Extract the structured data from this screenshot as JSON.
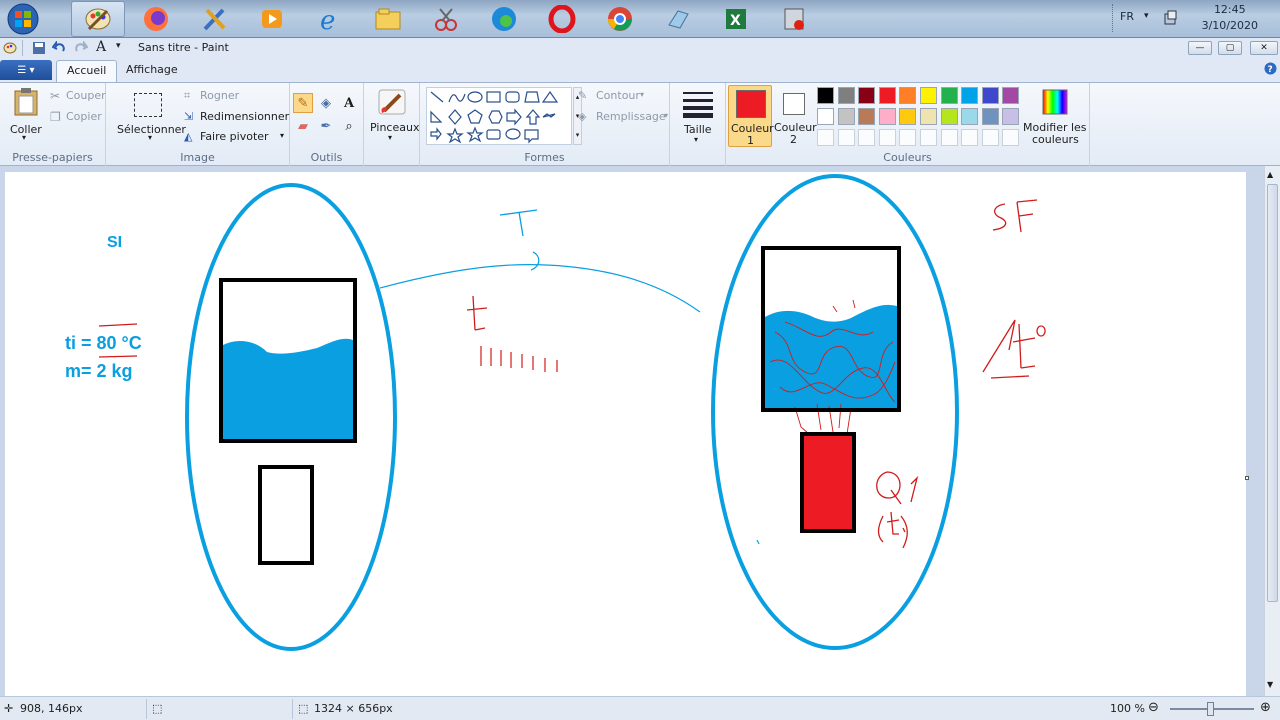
{
  "taskbar": {
    "apps": [
      "paint-icon",
      "firefox-icon",
      "brushes-app-icon",
      "media-player-icon",
      "internet-explorer-icon",
      "file-explorer-icon",
      "snipping-tool-icon",
      "edge-icon",
      "opera-icon",
      "chrome-icon",
      "notes-app-icon",
      "excel-icon",
      "recorder-icon"
    ],
    "lang": "FR",
    "time": "12:45",
    "date": "3/10/2020"
  },
  "window": {
    "title": "Sans titre - Paint",
    "min": "—",
    "max": "▢",
    "close": "✕"
  },
  "tabs": {
    "accueil": "Accueil",
    "affichage": "Affichage"
  },
  "ribbon": {
    "clipboard": {
      "coller": "Coller",
      "couper": "Couper",
      "copier": "Copier",
      "label": "Presse-papiers"
    },
    "image": {
      "selectionner": "Sélectionner",
      "rogner": "Rogner",
      "redimensionner": "Redimensionner",
      "faire_pivoter": "Faire pivoter",
      "label": "Image"
    },
    "tools": {
      "label": "Outils"
    },
    "brushes": {
      "label": "Pinceaux"
    },
    "shapes": {
      "contour": "Contour",
      "remplissage": "Remplissage",
      "label": "Formes"
    },
    "size": {
      "label": "Taille"
    },
    "colors": {
      "couleur1_a": "Couleur",
      "couleur1_b": "1",
      "couleur2_a": "Couleur",
      "couleur2_b": "2",
      "modifier_a": "Modifier les",
      "modifier_b": "couleurs",
      "label": "Couleurs",
      "color1": "#ed1c24",
      "color2": "#ffffff",
      "row1": [
        "#000000",
        "#7f7f7f",
        "#880015",
        "#ed1c24",
        "#ff7f27",
        "#fff200",
        "#22b14c",
        "#00a2e8",
        "#3f48cc",
        "#a349a4"
      ],
      "row2": [
        "#ffffff",
        "#c3c3c3",
        "#b97a57",
        "#ffaec9",
        "#ffc90e",
        "#efe4b0",
        "#b5e61d",
        "#99d9ea",
        "#7092be",
        "#c8bfe7"
      ]
    }
  },
  "drawing": {
    "si": "SI",
    "ti": "ti = 80 °C",
    "m": "m= 2 kg",
    "water_color": "#0a9fe1",
    "red": "#d11c1c"
  },
  "status": {
    "cursor": "908, 146px",
    "size": "1324 × 656px",
    "zoom": "100 %"
  }
}
